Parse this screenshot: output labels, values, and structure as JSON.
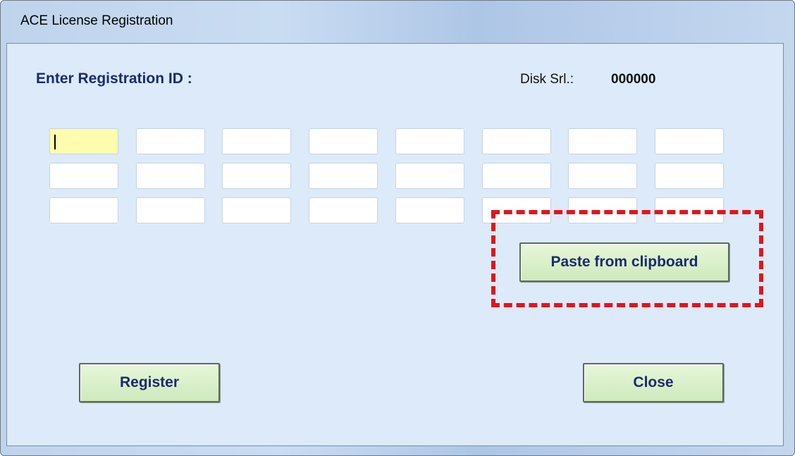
{
  "window": {
    "title": "ACE License Registration"
  },
  "form": {
    "heading": "Enter Registration ID :",
    "disk_label": "Disk Srl.:",
    "disk_value": "000000",
    "id_fields": [
      [
        "",
        "",
        "",
        "",
        "",
        "",
        "",
        ""
      ],
      [
        "",
        "",
        "",
        "",
        "",
        "",
        "",
        ""
      ],
      [
        "",
        "",
        "",
        "",
        "",
        "",
        "",
        ""
      ]
    ],
    "active_field": {
      "row": 1,
      "col": 1
    }
  },
  "buttons": {
    "paste_label": "Paste from clipboard",
    "register_label": "Register",
    "close_label": "Close"
  },
  "colors": {
    "accent_text": "#1c2a6e",
    "button_bg": "#cfe9bc",
    "active_field_bg": "#fffcad",
    "highlight_border": "#e0151f"
  }
}
